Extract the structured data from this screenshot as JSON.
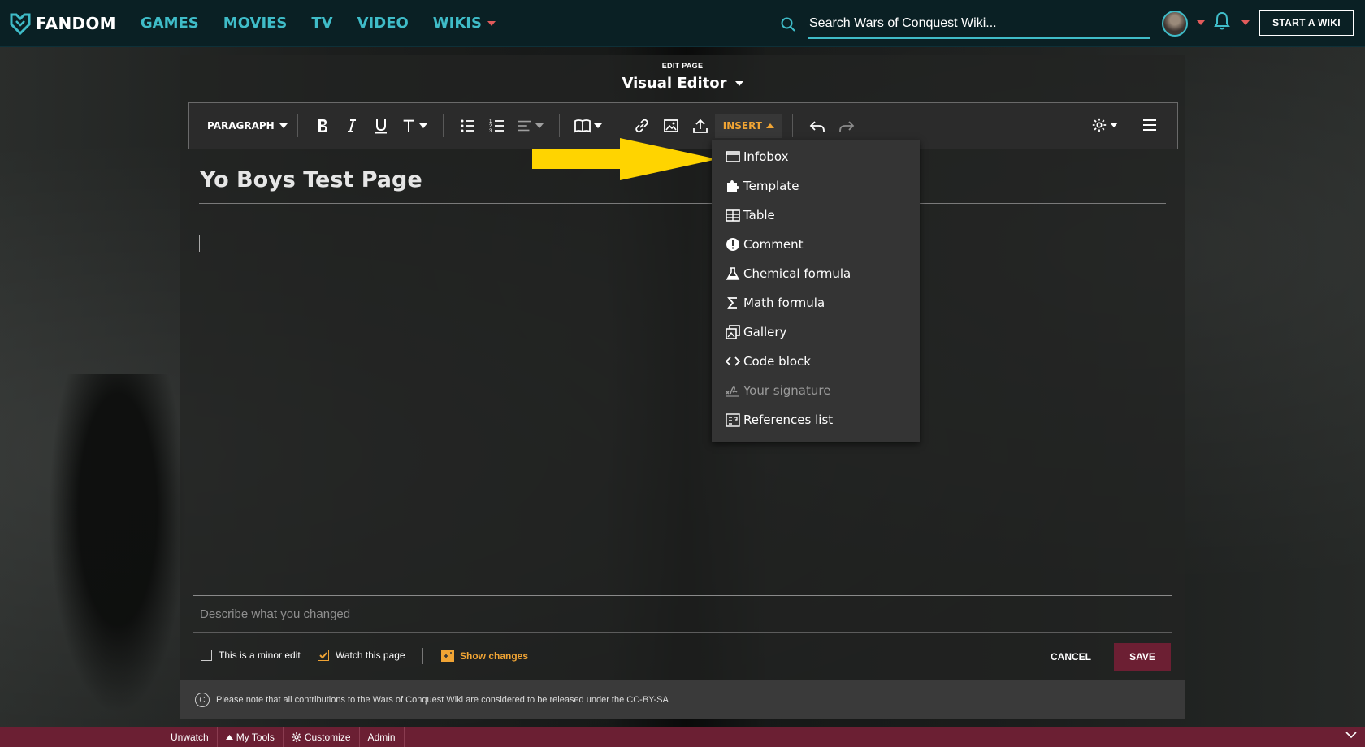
{
  "header": {
    "brand": "FANDOM",
    "nav": [
      "GAMES",
      "MOVIES",
      "TV",
      "VIDEO",
      "WIKIS"
    ],
    "search_placeholder": "Search Wars of Conquest Wiki...",
    "start_wiki": "START A WIKI"
  },
  "editor": {
    "kicker": "EDIT PAGE",
    "mode": "Visual Editor",
    "toolbar": {
      "paragraph": "PARAGRAPH",
      "insert": "INSERT"
    },
    "page_title": "Yo Boys Test Page"
  },
  "insert_menu": [
    {
      "label": "Infobox",
      "icon": "infobox-icon",
      "disabled": false
    },
    {
      "label": "Template",
      "icon": "puzzle-icon",
      "disabled": false
    },
    {
      "label": "Table",
      "icon": "table-icon",
      "disabled": false
    },
    {
      "label": "Comment",
      "icon": "comment-alert-icon",
      "disabled": false
    },
    {
      "label": "Chemical formula",
      "icon": "flask-icon",
      "disabled": false
    },
    {
      "label": "Math formula",
      "icon": "sigma-icon",
      "disabled": false
    },
    {
      "label": "Gallery",
      "icon": "gallery-icon",
      "disabled": false
    },
    {
      "label": "Code block",
      "icon": "code-icon",
      "disabled": false
    },
    {
      "label": "Your signature",
      "icon": "signature-icon",
      "disabled": true
    },
    {
      "label": "References list",
      "icon": "references-icon",
      "disabled": false
    }
  ],
  "save_panel": {
    "summary_placeholder": "Describe what you changed",
    "minor_edit": "This is a minor edit",
    "watch_page": "Watch this page",
    "show_changes": "Show changes",
    "cancel": "CANCEL",
    "save": "SAVE",
    "license": "Please note that all contributions to the Wars of Conquest Wiki are considered to be released under the CC-BY-SA"
  },
  "bottom_bar": [
    "Unwatch",
    "My Tools",
    "Customize",
    "Admin"
  ],
  "colors": {
    "accent_teal": "#3fbcc8",
    "insert_orange": "#f0a434",
    "save_maroon": "#6c1f33",
    "annotation_yellow": "#ffd400"
  }
}
